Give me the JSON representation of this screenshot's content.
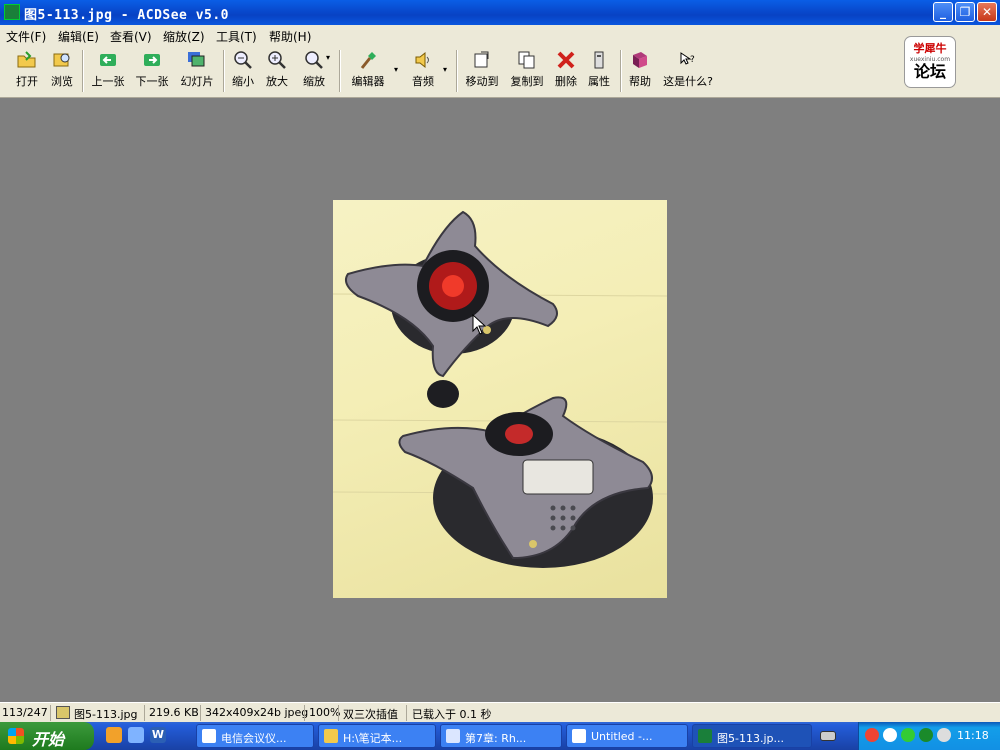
{
  "window": {
    "title": "图5-113.jpg - ACDSee v5.0"
  },
  "menu": [
    "文件(F)",
    "编辑(E)",
    "查看(V)",
    "缩放(Z)",
    "工具(T)",
    "帮助(H)"
  ],
  "toolbar": {
    "open": "打开",
    "browse": "浏览",
    "prev": "上一张",
    "next": "下一张",
    "slideshow": "幻灯片",
    "zoom_out": "缩小",
    "zoom_in": "放大",
    "zoom": "缩放",
    "editor": "编辑器",
    "audio": "音频",
    "move_to": "移动到",
    "copy_to": "复制到",
    "delete": "删除",
    "properties": "属性",
    "help": "帮助",
    "whats_this": "这是什么?"
  },
  "logo": {
    "cn_name": "学犀牛",
    "url_text": "xuexiniu.com",
    "forum": "论坛"
  },
  "status": {
    "position": "113/247",
    "filename": "图5-113.jpg",
    "filesize": "219.6 KB",
    "imageinfo": "342x409x24b jpeg",
    "zoom": "100%",
    "interp": "双三次插值",
    "loadtime": "已载入于 0.1 秒"
  },
  "taskbar": {
    "start": "开始",
    "tasks": [
      "电信会议仪...",
      "H:\\笔记本...",
      "第7章: Rh...",
      "Untitled -...",
      "图5-113.jp..."
    ],
    "clock": "11:18"
  },
  "colors": {
    "titlebar": "#0a5ee6",
    "viewer_bg": "#7f7f7f",
    "taskbar": "#245edb",
    "start": "#2d8a2d"
  }
}
